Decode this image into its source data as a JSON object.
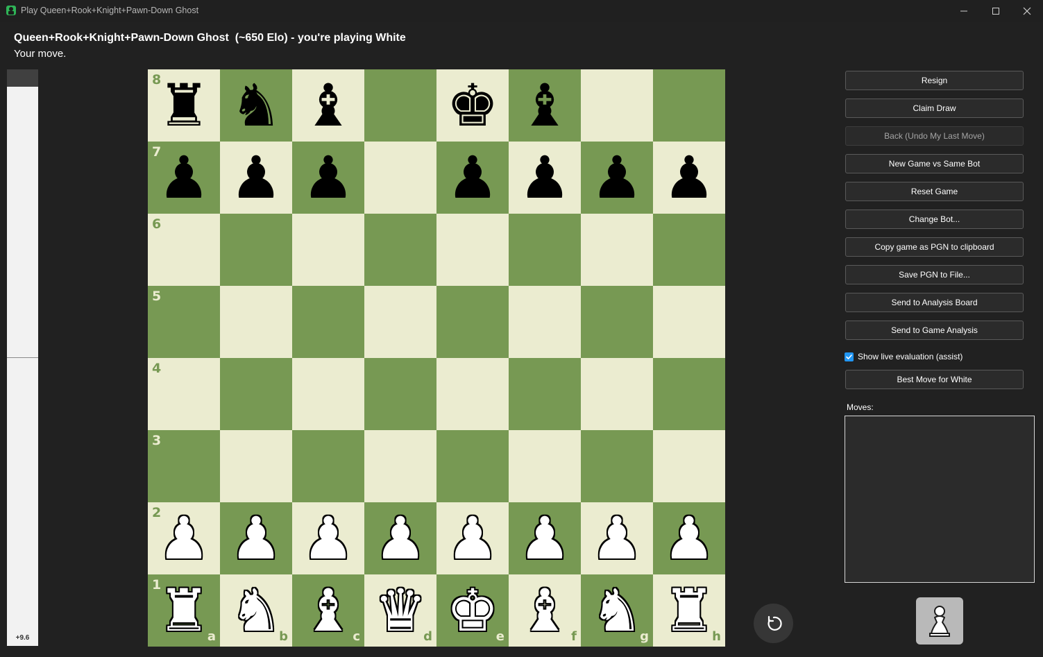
{
  "window": {
    "title": "Play Queen+Rook+Knight+Pawn-Down Ghost",
    "icon": "app-icon"
  },
  "header": {
    "title": "Queen+Rook+Knight+Pawn-Down Ghost  (~650 Elo) - you're playing White",
    "status": "Your move."
  },
  "eval": {
    "score": "+9.6",
    "white_fraction": 0.97
  },
  "board": {
    "ranks": [
      "8",
      "7",
      "6",
      "5",
      "4",
      "3",
      "2",
      "1"
    ],
    "files": [
      "a",
      "b",
      "c",
      "d",
      "e",
      "f",
      "g",
      "h"
    ],
    "rows": [
      [
        "r",
        "n",
        "b",
        "",
        "k",
        "b",
        "",
        ""
      ],
      [
        "p",
        "p",
        "p",
        "",
        "p",
        "p",
        "p",
        "p"
      ],
      [
        "",
        "",
        "",
        "",
        "",
        "",
        "",
        ""
      ],
      [
        "",
        "",
        "",
        "",
        "",
        "",
        "",
        ""
      ],
      [
        "",
        "",
        "",
        "",
        "",
        "",
        "",
        ""
      ],
      [
        "",
        "",
        "",
        "",
        "",
        "",
        "",
        ""
      ],
      [
        "P",
        "P",
        "P",
        "P",
        "P",
        "P",
        "P",
        "P"
      ],
      [
        "R",
        "N",
        "B",
        "Q",
        "K",
        "B",
        "N",
        "R"
      ]
    ],
    "colors": {
      "light": "#ebecd0",
      "dark": "#779953"
    }
  },
  "buttons": {
    "resign": "Resign",
    "claim_draw": "Claim Draw",
    "undo": "Back (Undo My Last Move)",
    "new_game": "New Game vs Same Bot",
    "reset": "Reset Game",
    "change_bot": "Change Bot...",
    "copy_pgn": "Copy game as PGN to clipboard",
    "save_pgn": "Save PGN to File...",
    "send_analysis_board": "Send to Analysis Board",
    "send_game_analysis": "Send to Game Analysis",
    "best_move": "Best Move for White"
  },
  "live_eval": {
    "label": "Show live evaluation (assist)",
    "checked": true
  },
  "moves": {
    "label": "Moves:",
    "list": []
  },
  "accent": "#2196f3"
}
